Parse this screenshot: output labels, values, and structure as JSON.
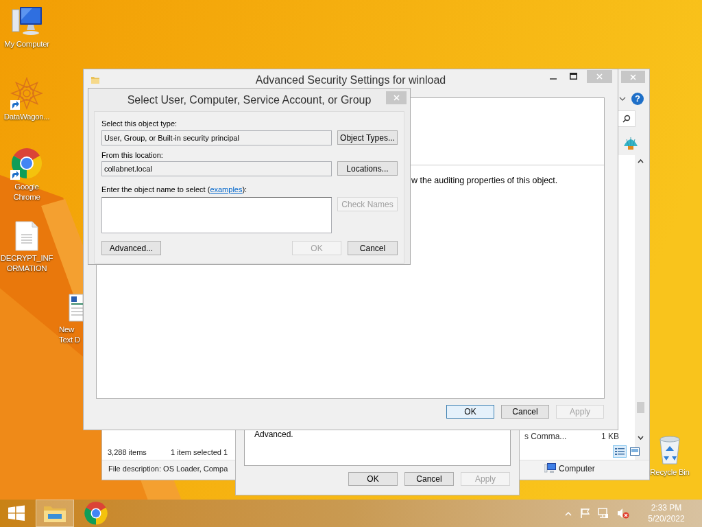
{
  "desktop_icons": [
    {
      "kind": "computer",
      "lines": [
        "My Computer"
      ]
    },
    {
      "kind": "shortcut-app",
      "lines": [
        "DataWagon..."
      ]
    },
    {
      "kind": "chrome",
      "lines": [
        "Google",
        "Chrome"
      ]
    },
    {
      "kind": "document",
      "lines": [
        "DECRYPT_INF",
        "ORMATION"
      ]
    },
    {
      "kind": "rich-document",
      "lines": [
        "New",
        "Text D"
      ]
    },
    {
      "kind": "recycle-bin",
      "lines": [
        "Recycle Bin"
      ]
    }
  ],
  "explorer_window": {
    "help": "?",
    "file_row": {
      "name": "s Comma...",
      "size": "1 KB"
    },
    "status_bar": {
      "count": "3,288 items",
      "selection": "1 item selected 1"
    },
    "views": [
      {
        "kind": "details",
        "selected": true
      },
      {
        "kind": "preview",
        "selected": false
      }
    ],
    "details_pane": {
      "description": "File description: OS Loader, Compa",
      "location": "Computer"
    }
  },
  "properties_dialog": {
    "text": "Advanced.",
    "buttons": [
      {
        "label": "OK",
        "default": false,
        "disabled": false
      },
      {
        "label": "Cancel",
        "default": false,
        "disabled": false
      },
      {
        "label": "Apply",
        "default": false,
        "disabled": true
      }
    ]
  },
  "security_window": {
    "title": "Advanced Security Settings for winload",
    "description": "w the auditing properties of this object.",
    "buttons": [
      {
        "label": "OK",
        "default": true,
        "disabled": false
      },
      {
        "label": "Cancel",
        "default": false,
        "disabled": false
      },
      {
        "label": "Apply",
        "default": false,
        "disabled": true
      }
    ]
  },
  "select_dialog": {
    "title": "Select User, Computer, Service Account, or Group",
    "object_type_label": "Select this object type:",
    "object_type": "User, Group, or Built-in security principal",
    "object_types_button": {
      "label": "Object Types...",
      "default": false,
      "disabled": false
    },
    "location_label": "From this location:",
    "location": "collabnet.local",
    "locations_button": {
      "label": "Locations...",
      "default": false,
      "disabled": false
    },
    "name_prompt": {
      "before": "Enter the object name to select (",
      "link": "examples",
      "after": "):"
    },
    "check_names_button": {
      "label": "Check Names",
      "default": false,
      "disabled": true
    },
    "buttons": [
      {
        "label": "Advanced...",
        "default": false,
        "disabled": false
      },
      {
        "label": "OK",
        "default": false,
        "disabled": true
      },
      {
        "label": "Cancel",
        "default": false,
        "disabled": false
      }
    ]
  },
  "taskbar": {
    "apps": [
      {
        "kind": "explorer",
        "selected": true
      },
      {
        "kind": "chrome",
        "selected": false
      }
    ],
    "clock": {
      "time": "2:33 PM",
      "date": "5/20/2022"
    }
  }
}
